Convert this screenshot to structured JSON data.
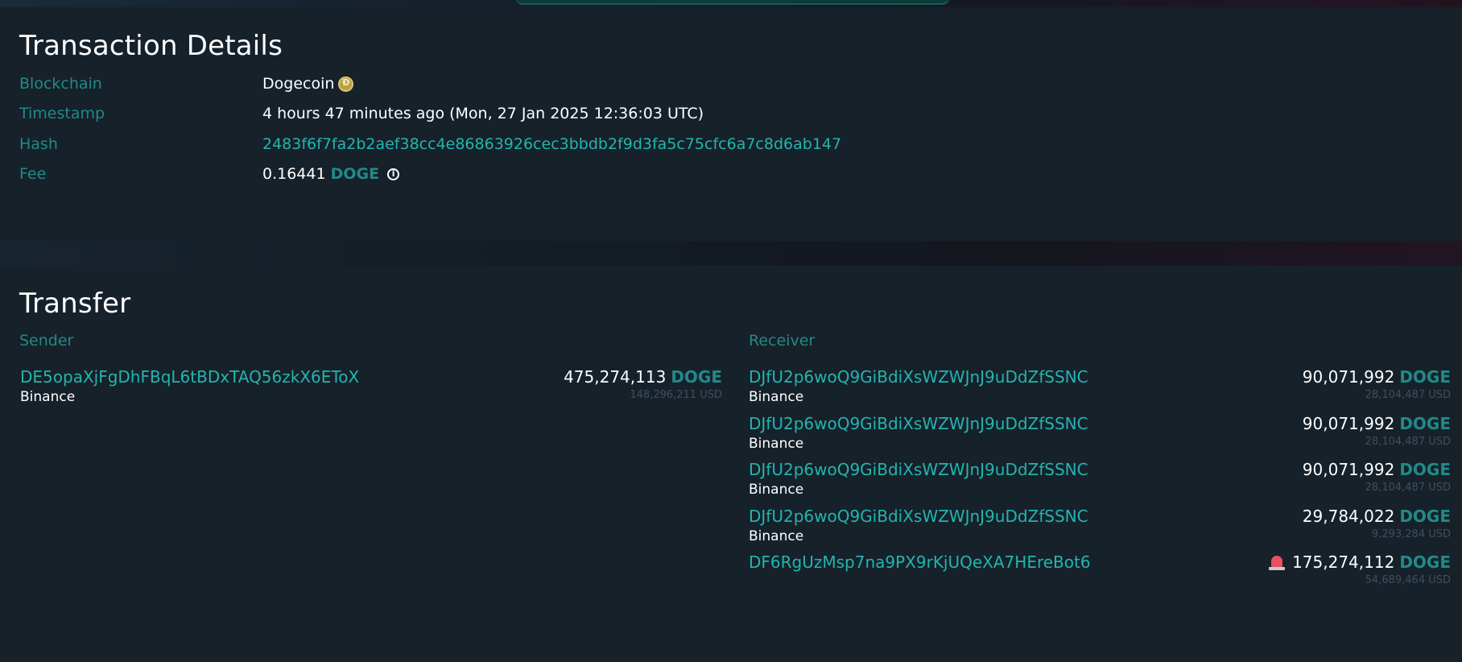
{
  "details": {
    "title": "Transaction Details",
    "blockchain_label": "Blockchain",
    "blockchain_value": "Dogecoin",
    "timestamp_label": "Timestamp",
    "timestamp_value": "4 hours 47 minutes ago (Mon, 27 Jan 2025 12:36:03 UTC)",
    "hash_label": "Hash",
    "hash_value": "2483f6f7fa2b2aef38cc4e86863926cec3bbdb2f9d3fa5c75cfc6a7c8d6ab147",
    "fee_label": "Fee",
    "fee_amount": "0.16441",
    "fee_unit": "DOGE"
  },
  "transfer": {
    "title": "Transfer",
    "sender_heading": "Sender",
    "receiver_heading": "Receiver",
    "senders": [
      {
        "address": "DE5opaXjFgDhFBqL6tBDxTAQ56zkX6EToX",
        "owner": "Binance",
        "amount": "475,274,113",
        "unit": "DOGE",
        "usd": "148,296,211 USD"
      }
    ],
    "receivers": [
      {
        "address": "DJfU2p6woQ9GiBdiXsWZWJnJ9uDdZfSSNC",
        "owner": "Binance",
        "amount": "90,071,992",
        "unit": "DOGE",
        "usd": "28,104,487 USD"
      },
      {
        "address": "DJfU2p6woQ9GiBdiXsWZWJnJ9uDdZfSSNC",
        "owner": "Binance",
        "amount": "90,071,992",
        "unit": "DOGE",
        "usd": "28,104,487 USD"
      },
      {
        "address": "DJfU2p6woQ9GiBdiXsWZWJnJ9uDdZfSSNC",
        "owner": "Binance",
        "amount": "90,071,992",
        "unit": "DOGE",
        "usd": "28,104,487 USD"
      },
      {
        "address": "DJfU2p6woQ9GiBdiXsWZWJnJ9uDdZfSSNC",
        "owner": "Binance",
        "amount": "29,784,022",
        "unit": "DOGE",
        "usd": "9,293,284 USD"
      },
      {
        "address": "DF6RgUzMsp7na9PX9rKjUQeXA7HEreBot6",
        "owner": "",
        "amount": "175,274,112",
        "unit": "DOGE",
        "usd": "54,689,464 USD",
        "icon": "alert-siren-icon"
      }
    ]
  },
  "colors": {
    "background": "#16212a",
    "accent": "#22b5b0",
    "label": "#218a88",
    "muted": "#3f4f5c",
    "alert": "#e8505e"
  }
}
